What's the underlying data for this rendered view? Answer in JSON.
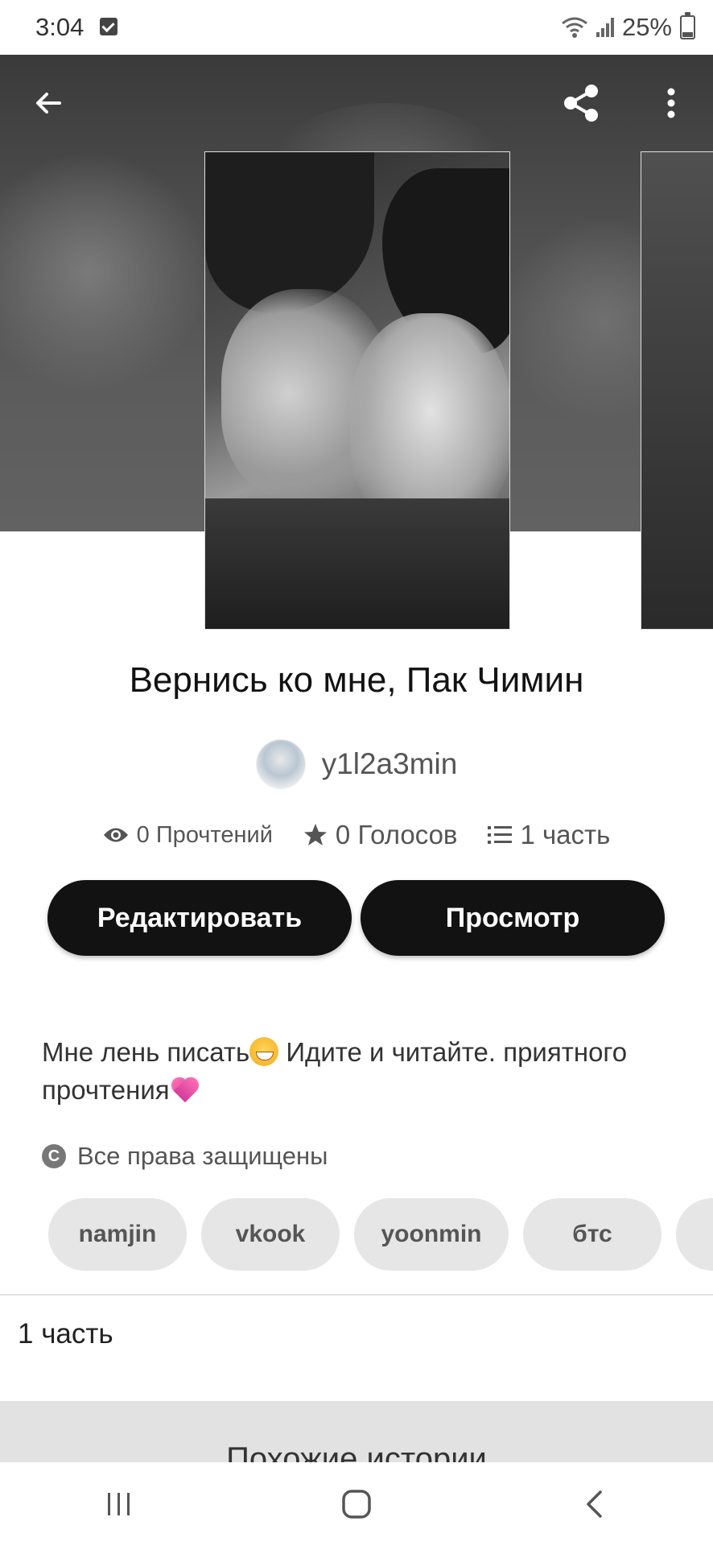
{
  "status_bar": {
    "time": "3:04",
    "battery": "25%",
    "battery_level": 0.25
  },
  "toolbar": {
    "back_icon": "arrow-left-icon",
    "share_icon": "share-icon",
    "more_icon": "more-vertical-icon"
  },
  "story": {
    "title": "Вернись ко мне, Пак Чимин",
    "author": "y1l2a3min",
    "reads": "0 Прочтений",
    "votes": "0 Голосов",
    "parts": "1 часть"
  },
  "actions": {
    "edit_label": "Редактировать",
    "view_label": "Просмотр"
  },
  "description": {
    "part1": "Мне лень писать",
    "part2": " Идите и читайте. приятного прочтения "
  },
  "copyright": "Все права защищены",
  "tags": [
    "namjin",
    "vkook",
    "yoonmin",
    "бтс"
  ],
  "parts_section": {
    "label": "1 часть"
  },
  "similar": {
    "title": "Похожие истории"
  },
  "colors": {
    "button_bg": "#121212",
    "tag_bg": "#e6e6e6",
    "text_secondary": "#555555"
  }
}
